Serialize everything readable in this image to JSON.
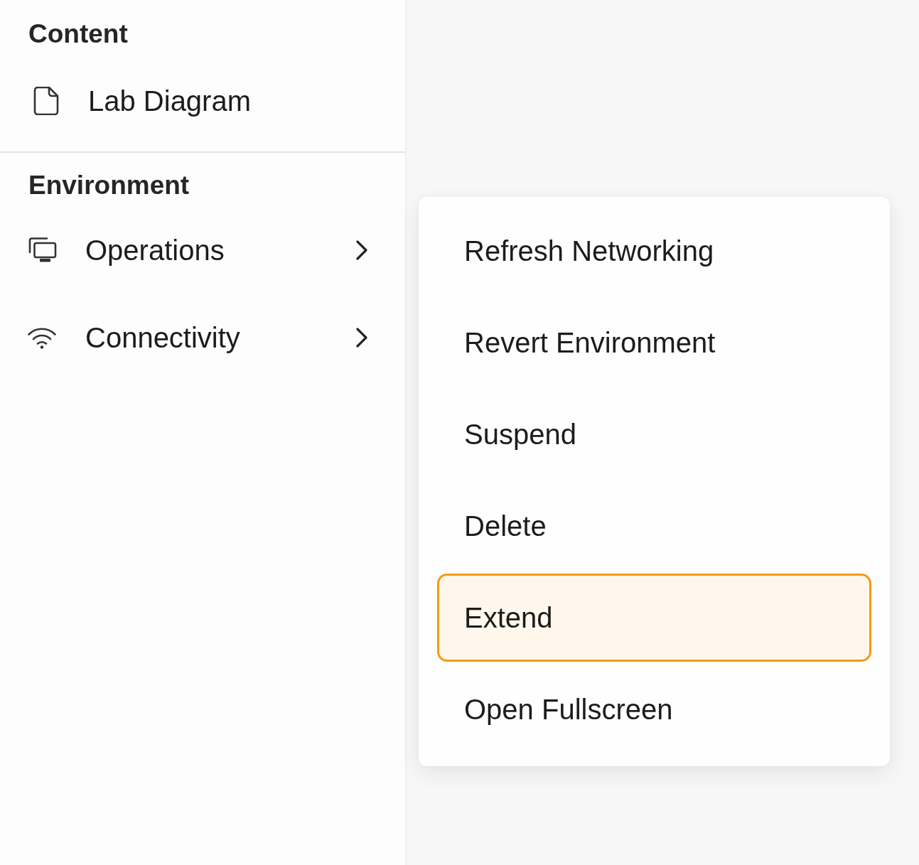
{
  "sidebar": {
    "sections": [
      {
        "title": "Content",
        "items": [
          {
            "label": "Lab Diagram",
            "submenu": false
          }
        ]
      },
      {
        "title": "Environment",
        "items": [
          {
            "label": "Operations",
            "submenu": true
          },
          {
            "label": "Connectivity",
            "submenu": true
          }
        ]
      }
    ]
  },
  "context_menu": {
    "items": [
      {
        "label": "Refresh Networking",
        "selected": false
      },
      {
        "label": "Revert Environment",
        "selected": false
      },
      {
        "label": "Suspend",
        "selected": false
      },
      {
        "label": "Delete",
        "selected": false
      },
      {
        "label": "Extend",
        "selected": true
      },
      {
        "label": "Open Fullscreen",
        "selected": false
      }
    ]
  }
}
